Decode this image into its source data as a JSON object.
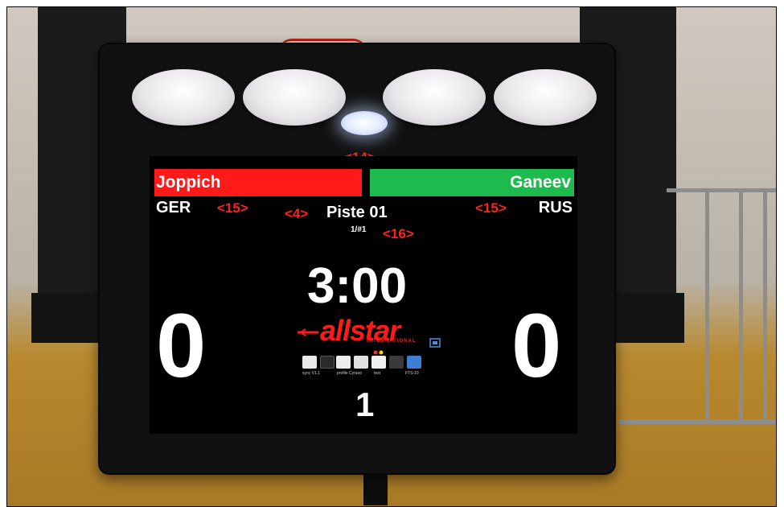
{
  "scoreboard": {
    "call_out_top": "<14>",
    "left_fencer": {
      "name": "Joppich",
      "country": "GER",
      "score": "0",
      "callout": "<15>"
    },
    "right_fencer": {
      "name": "Ganeev",
      "country": "RUS",
      "score": "0",
      "callout": "<15>"
    },
    "piste_callout": "<4>",
    "piste_label": "Piste 01",
    "round_text": "1/#1",
    "round_callout": "<16>",
    "timer": "3:00",
    "period": "1",
    "logo_text": "allstar",
    "logo_subtext": "INTERNATIONAL",
    "icons": [
      {
        "name": "sync-icon",
        "label": "sync\nV1.1"
      },
      {
        "name": "circle-icon",
        "label": ""
      },
      {
        "name": "profile-icon",
        "label": "profile Cyrano"
      },
      {
        "name": "list-icon",
        "label": ""
      },
      {
        "name": "test-icon",
        "label": "test"
      },
      {
        "name": "grid-icon",
        "label": ""
      },
      {
        "name": "info-icon",
        "label": "FTS-10"
      }
    ]
  },
  "colors": {
    "left_bar": "#ff1a1a",
    "right_bar": "#1dbb4e",
    "callout_red": "#ff2020"
  }
}
